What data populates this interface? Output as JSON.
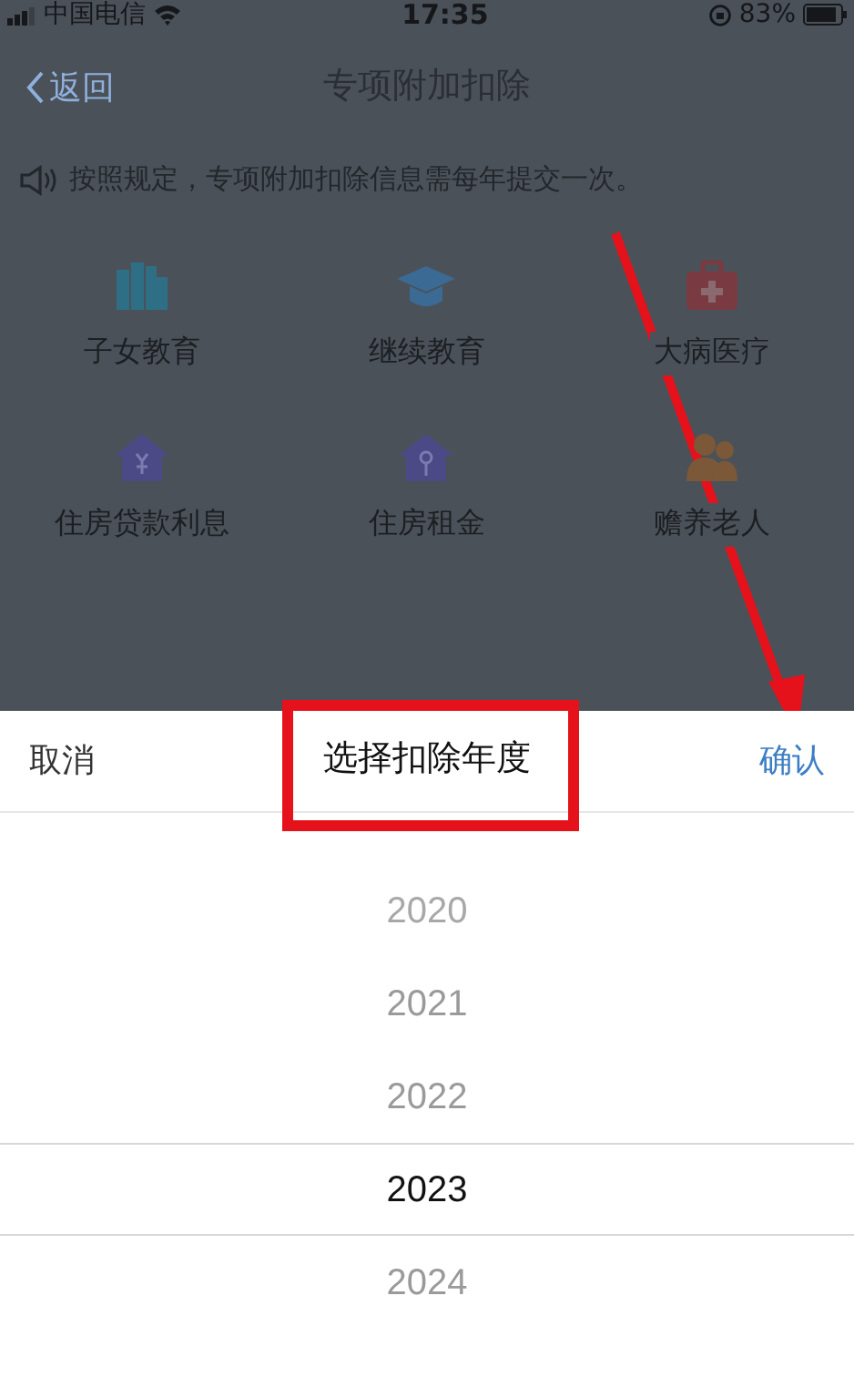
{
  "status_bar": {
    "carrier": "中国电信",
    "time": "17:35",
    "battery": "83%"
  },
  "nav": {
    "back": "返回",
    "title": "专项附加扣除"
  },
  "notice": "按照规定，专项附加扣除信息需每年提交一次。",
  "categories": [
    {
      "label": "子女教育",
      "kind": "books",
      "color": "#2f6f86"
    },
    {
      "label": "继续教育",
      "kind": "cap",
      "color": "#3b6a94"
    },
    {
      "label": "大病医疗",
      "kind": "medkit",
      "color": "#7a3a42"
    },
    {
      "label": "住房贷款利息",
      "kind": "house",
      "color": "#4c4a86"
    },
    {
      "label": "住房租金",
      "kind": "housekey",
      "color": "#4c4a86"
    },
    {
      "label": "赡养老人",
      "kind": "elder",
      "color": "#7a5838"
    }
  ],
  "picker": {
    "cancel": "取消",
    "title": "选择扣除年度",
    "confirm": "确认",
    "years": [
      {
        "label": "2020",
        "selected": false
      },
      {
        "label": "2021",
        "selected": false
      },
      {
        "label": "2022",
        "selected": false
      },
      {
        "label": "2023",
        "selected": true
      },
      {
        "label": "2024",
        "selected": false
      }
    ]
  }
}
